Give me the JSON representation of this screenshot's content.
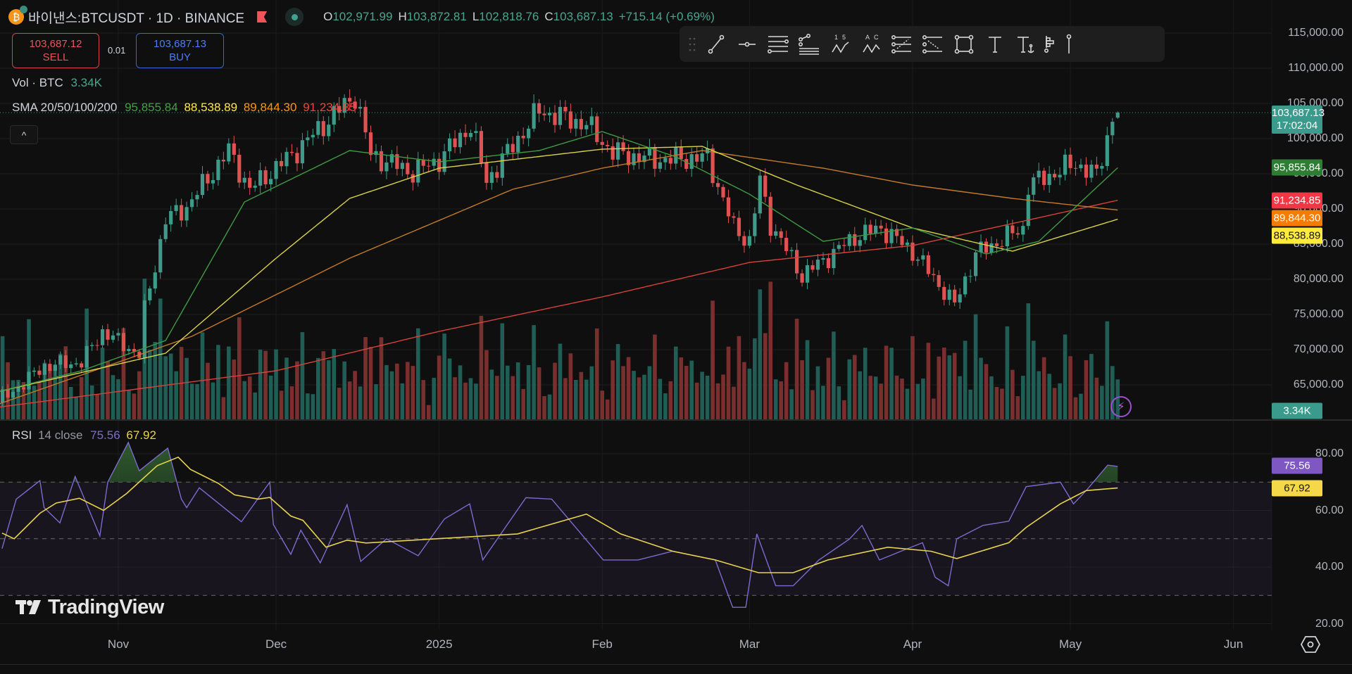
{
  "header": {
    "symbol": "바이낸스:BTCUSDT · 1D · BINANCE",
    "ohlc": [
      {
        "k": "O",
        "v": "102,971.99"
      },
      {
        "k": "H",
        "v": "103,872.81"
      },
      {
        "k": "L",
        "v": "102,818.76"
      },
      {
        "k": "C",
        "v": "103,687.13"
      }
    ],
    "change": "+715.14 (+0.69%)"
  },
  "trade": {
    "sell_price": "103,687.12",
    "sell_label": "SELL",
    "spread": "0.01",
    "buy_price": "103,687.13",
    "buy_label": "BUY"
  },
  "indicators": {
    "vol_label": "Vol · BTC",
    "vol_value": "3.34K",
    "sma_label": "SMA 20/50/100/200",
    "sma_values": [
      "95,855.84",
      "88,538.89",
      "89,844.30",
      "91,234.85"
    ],
    "rsi_label": "RSI",
    "rsi_params": "14 close",
    "rsi_value": "75.56",
    "rsi_ma_value": "67.92"
  },
  "colors": {
    "up": "#3e9b8a",
    "down": "#e05252",
    "sma20": "#3f9a44",
    "sma50": "#d8d24a",
    "sma100": "#c07a2a",
    "sma200": "#d7423c",
    "rsi": "#7e6bd0",
    "rsi_ma": "#e8d44d"
  },
  "toolbar": [
    "drag-handle",
    "trend-line",
    "horizontal-ray",
    "parallel-channel",
    "fib-retracement",
    "elliott-wave-15",
    "abc-pattern",
    "fib-channel",
    "regression-trend",
    "rectangle",
    "text",
    "anchored-text",
    "volume-profile",
    "price-note"
  ],
  "price_axis": {
    "labels": [
      "115,000.00",
      "110,000.00",
      "105,000.00",
      "100,000.00",
      "95,000.00",
      "90,000.00",
      "85,000.00",
      "80,000.00",
      "75,000.00",
      "70,000.00",
      "65,000.00"
    ],
    "values": [
      115000,
      110000,
      105000,
      100000,
      95000,
      90000,
      85000,
      80000,
      75000,
      70000,
      65000
    ],
    "last_price": "103,687.13",
    "countdown": "17:02:04",
    "badges": [
      {
        "text": "95,855.84",
        "value": 95855.84,
        "bg": "#2e7d32",
        "fg": "#ffffff"
      },
      {
        "text": "91,234.85",
        "value": 91234.85,
        "bg": "#f23645",
        "fg": "#ffffff"
      },
      {
        "text": "89,844.30",
        "value": 89844.3,
        "bg": "#f57c00",
        "fg": "#ffffff"
      },
      {
        "text": "88,538.89",
        "value": 88538.89,
        "bg": "#ffeb3b",
        "fg": "#131313"
      }
    ],
    "vol_badge": "3.34K"
  },
  "rsi_axis": {
    "labels": [
      "80.00",
      "60.00",
      "40.00",
      "20.00"
    ],
    "values": [
      80,
      60,
      40,
      20
    ],
    "rsi_badge": "75.56",
    "ma_badge": "67.92"
  },
  "time_axis": [
    {
      "label": "Nov",
      "day": 31
    },
    {
      "label": "Dec",
      "day": 61
    },
    {
      "label": "2025",
      "day": 92
    },
    {
      "label": "Feb",
      "day": 123
    },
    {
      "label": "Mar",
      "day": 151
    },
    {
      "label": "Apr",
      "day": 182
    },
    {
      "label": "May",
      "day": 212
    },
    {
      "label": "Jun",
      "day": 243
    }
  ],
  "watermark": "TradingView",
  "chart_data": {
    "type": "candlestick",
    "x_unit": "days since 2024-10-01",
    "first_day": 8,
    "last_day": 221,
    "last_candle": {
      "o": 102971.99,
      "h": 103872.81,
      "l": 102818.76,
      "c": 103687.13
    },
    "close_anchors": [
      [
        8,
        62800
      ],
      [
        10,
        63500
      ],
      [
        17,
        67700
      ],
      [
        24,
        68200
      ],
      [
        28,
        72600
      ],
      [
        35,
        69300
      ],
      [
        36,
        75600
      ],
      [
        40,
        88500
      ],
      [
        44,
        90300
      ],
      [
        52,
        98300
      ],
      [
        56,
        92800
      ],
      [
        64,
        97700
      ],
      [
        76,
        106200
      ],
      [
        79,
        97700
      ],
      [
        87,
        95200
      ],
      [
        92,
        97000
      ],
      [
        98,
        101900
      ],
      [
        101,
        94000
      ],
      [
        104,
        97000
      ],
      [
        111,
        104000
      ],
      [
        120,
        102000
      ],
      [
        125,
        98000
      ],
      [
        133,
        97000
      ],
      [
        143,
        97300
      ],
      [
        148,
        87300
      ],
      [
        151,
        85400
      ],
      [
        153,
        94000
      ],
      [
        155,
        87900
      ],
      [
        161,
        80500
      ],
      [
        171,
        86000
      ],
      [
        176,
        87300
      ],
      [
        182,
        84000
      ],
      [
        190,
        76400
      ],
      [
        194,
        83600
      ],
      [
        203,
        87300
      ],
      [
        204,
        93400
      ],
      [
        213,
        96500
      ],
      [
        217,
        94700
      ],
      [
        220,
        103000
      ],
      [
        221,
        103687.13
      ]
    ],
    "sma20": [
      [
        8,
        64000
      ],
      [
        24,
        67000
      ],
      [
        40,
        71300
      ],
      [
        55,
        91000
      ],
      [
        75,
        98300
      ],
      [
        92,
        96700
      ],
      [
        111,
        98300
      ],
      [
        123,
        101000
      ],
      [
        137,
        97400
      ],
      [
        151,
        92100
      ],
      [
        165,
        85400
      ],
      [
        182,
        87300
      ],
      [
        196,
        83600
      ],
      [
        206,
        85400
      ],
      [
        221,
        95855.84
      ]
    ],
    "sma50": [
      [
        8,
        64000
      ],
      [
        40,
        69500
      ],
      [
        61,
        83000
      ],
      [
        75,
        91500
      ],
      [
        92,
        95800
      ],
      [
        123,
        98500
      ],
      [
        142,
        98900
      ],
      [
        160,
        93400
      ],
      [
        182,
        87300
      ],
      [
        201,
        84000
      ],
      [
        221,
        88538.89
      ]
    ],
    "sma100": [
      [
        8,
        62200
      ],
      [
        45,
        71900
      ],
      [
        75,
        83000
      ],
      [
        106,
        92800
      ],
      [
        123,
        95800
      ],
      [
        142,
        98300
      ],
      [
        165,
        95800
      ],
      [
        182,
        93400
      ],
      [
        201,
        91500
      ],
      [
        221,
        89844.3
      ]
    ],
    "sma200": [
      [
        8,
        61800
      ],
      [
        61,
        67000
      ],
      [
        92,
        72600
      ],
      [
        123,
        77500
      ],
      [
        151,
        82400
      ],
      [
        182,
        84800
      ],
      [
        221,
        91234.85
      ]
    ],
    "rsi": [
      [
        8.9,
        46.5
      ],
      [
        11.6,
        64
      ],
      [
        16.1,
        70.5
      ],
      [
        16.9,
        61
      ],
      [
        19.9,
        55.6
      ],
      [
        22.8,
        72
      ],
      [
        27.5,
        51
      ],
      [
        29,
        70
      ],
      [
        32.9,
        84
      ],
      [
        35,
        74
      ],
      [
        40.4,
        82
      ],
      [
        43,
        64
      ],
      [
        44,
        61
      ],
      [
        46.4,
        68
      ],
      [
        54.4,
        56
      ],
      [
        59.8,
        70
      ],
      [
        60.5,
        55
      ],
      [
        63.8,
        44.5
      ],
      [
        65.7,
        53
      ],
      [
        69.4,
        41.5
      ],
      [
        74.5,
        62
      ],
      [
        77.1,
        42
      ],
      [
        82,
        50
      ],
      [
        88,
        44
      ],
      [
        93,
        57
      ],
      [
        97.8,
        62.3
      ],
      [
        100.3,
        42.5
      ],
      [
        108.5,
        64.5
      ],
      [
        113.4,
        64
      ],
      [
        123.2,
        42.5
      ],
      [
        129.8,
        42.5
      ],
      [
        136.4,
        45.6
      ],
      [
        144.5,
        42.5
      ],
      [
        147.8,
        25.8
      ],
      [
        150.3,
        25.8
      ],
      [
        152.4,
        51.7
      ],
      [
        156,
        33.4
      ],
      [
        159.3,
        33.4
      ],
      [
        164.2,
        42.5
      ],
      [
        170,
        49.9
      ],
      [
        172.4,
        54.7
      ],
      [
        175.7,
        42.5
      ],
      [
        179.8,
        45.6
      ],
      [
        183.9,
        48.6
      ],
      [
        186.3,
        36.4
      ],
      [
        188.8,
        33.4
      ],
      [
        190.4,
        50
      ],
      [
        195.4,
        54.7
      ],
      [
        200.3,
        56.2
      ],
      [
        203.6,
        68.4
      ],
      [
        210.1,
        70
      ],
      [
        212.6,
        62.3
      ],
      [
        215,
        67
      ],
      [
        219.1,
        76
      ],
      [
        221,
        75.56
      ]
    ],
    "rsi_ma": [
      [
        8.9,
        52
      ],
      [
        11.2,
        50
      ],
      [
        16.1,
        59
      ],
      [
        19.2,
        62.6
      ],
      [
        23.6,
        64.3
      ],
      [
        28.2,
        60
      ],
      [
        32.6,
        66
      ],
      [
        38.4,
        75.8
      ],
      [
        42.4,
        78.8
      ],
      [
        44.7,
        74.5
      ],
      [
        50,
        69.6
      ],
      [
        53.1,
        65.5
      ],
      [
        57.6,
        64
      ],
      [
        59.8,
        64.6
      ],
      [
        63.8,
        58
      ],
      [
        66.1,
        56.5
      ],
      [
        70.5,
        47
      ],
      [
        74.5,
        49.5
      ],
      [
        78.1,
        48.5
      ],
      [
        106.9,
        51.7
      ],
      [
        120,
        58.7
      ],
      [
        126.5,
        51.7
      ],
      [
        136.4,
        45.6
      ],
      [
        144.5,
        42.5
      ],
      [
        152.7,
        38
      ],
      [
        159.3,
        38
      ],
      [
        165.9,
        42.5
      ],
      [
        177.3,
        47
      ],
      [
        185.5,
        45.6
      ],
      [
        190.4,
        43
      ],
      [
        200.3,
        48.6
      ],
      [
        203.6,
        54
      ],
      [
        210.1,
        62.3
      ],
      [
        215,
        67
      ],
      [
        221,
        67.92
      ]
    ],
    "rsi_bands": [
      70,
      50,
      30
    ],
    "ylim": [
      62000,
      117000
    ]
  }
}
